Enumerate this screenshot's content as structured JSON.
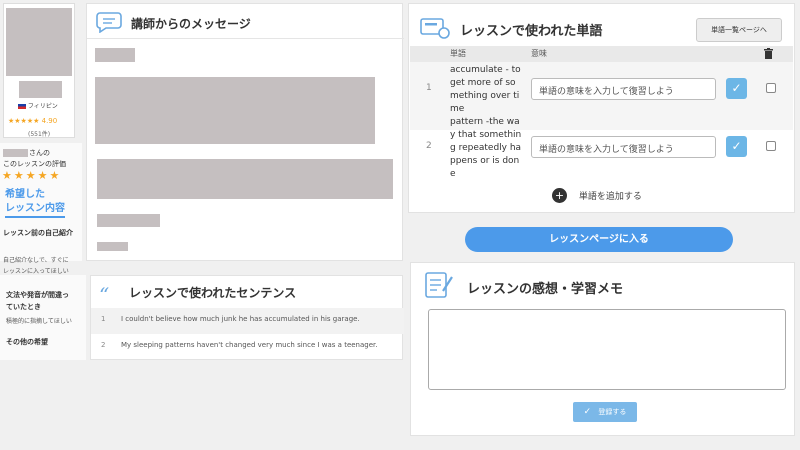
{
  "tutor": {
    "country": "フィリピン",
    "rating": "4.90",
    "review_count": "(551件)",
    "stars": "★★★★★"
  },
  "left_panel": {
    "rating_label_suffix": "さんの",
    "rating_label": "このレッスンの評価",
    "rating_stars": "★★★★★",
    "requests_title_1": "希望した",
    "requests_title_2": "レッスン内容",
    "self_intro_title": "レッスン前の自己紹介",
    "self_intro_text_1": "自己紹介なしで、すぐに",
    "self_intro_text_2": "レッスンに入ってほしい",
    "grammar_title_1": "文法や発音が間違っ",
    "grammar_title_2": "ていたとき",
    "grammar_text": "積極的に指摘してほしい",
    "other_title": "その他の希望"
  },
  "message": {
    "title": "講師からのメッセージ"
  },
  "sentences": {
    "title": "レッスンで使われたセンテンス",
    "items": [
      {
        "num": "1",
        "text": "I couldn't believe how much junk he has accumulated in his garage."
      },
      {
        "num": "2",
        "text": "My sleeping patterns haven't changed very much since I was a teenager."
      }
    ]
  },
  "vocab": {
    "title": "レッスンで使われた単語",
    "list_button": "単語一覧ページへ",
    "col_word": "単語",
    "col_meaning": "意味",
    "rows": [
      {
        "num": "1",
        "word_lines": [
          "accumulate - to",
          "get more of so",
          "mething over ti",
          "me"
        ],
        "placeholder": "単語の意味を入力して復習しよう"
      },
      {
        "num": "2",
        "word_lines": [
          "pattern -the wa",
          "y that somethin",
          "g repeatedly ha",
          "ppens or is don",
          "e"
        ],
        "placeholder": "単語の意味を入力して復習しよう"
      }
    ],
    "add_label": "単語を追加する"
  },
  "enter_lesson": {
    "label": "レッスンページに入る"
  },
  "memo": {
    "title": "レッスンの感想・学習メモ",
    "value": "",
    "submit_label": "登録する"
  },
  "colors": {
    "accent_blue": "#4c9aea",
    "check_blue": "#6cb6e6",
    "star": "#f5a623",
    "placeholder_gray": "#c5bfc0"
  }
}
